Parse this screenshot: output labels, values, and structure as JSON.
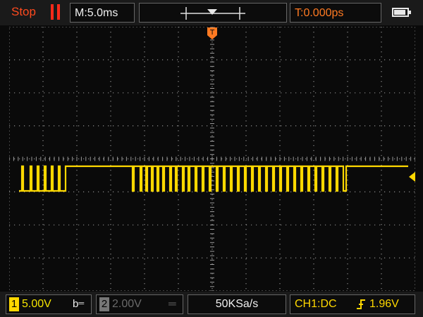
{
  "status": {
    "run_state": "Stop",
    "pause_icon": "pause-icon"
  },
  "timebase": {
    "label": "M:5.0ms"
  },
  "trigger_position": {
    "icon": "trigger-position-icon"
  },
  "trigger_time": {
    "label": "T:0.000ps"
  },
  "battery": {
    "icon": "battery-icon",
    "level": 0.8
  },
  "channel1": {
    "number": "1",
    "volts_div": "5.00V",
    "coupling": "b",
    "color": "#ffd800"
  },
  "channel2": {
    "number": "2",
    "volts_div": "2.00V",
    "coupling": "",
    "color": "#777777"
  },
  "sample_rate": {
    "label": "50KSa/s"
  },
  "trigger": {
    "source": "CH1:DC",
    "edge_icon": "rising-edge-icon",
    "level": "1.96V"
  },
  "colors": {
    "accent_red": "#ff4a1e",
    "trigger_orange": "#ff7a22",
    "trace_yellow": "#ffd800"
  }
}
